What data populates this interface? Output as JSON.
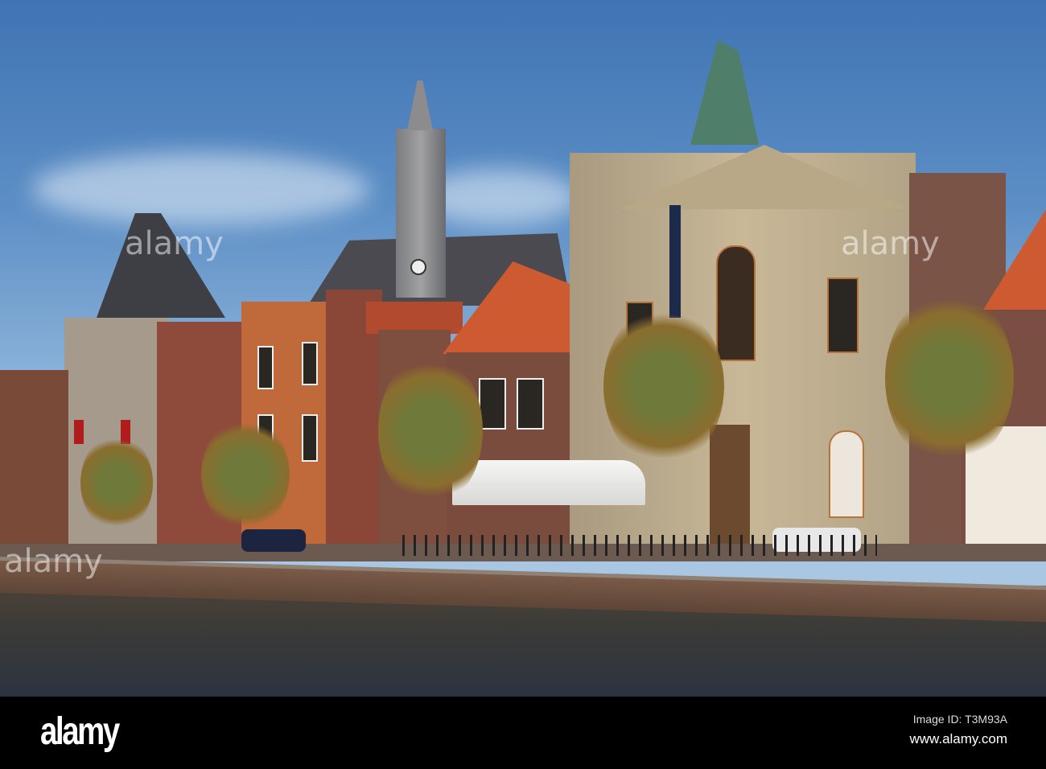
{
  "watermark": {
    "logo": "alamy",
    "image_id": "Image ID: T3M93A",
    "url": "www.alamy.com"
  },
  "colors": {
    "sky": "#4f83bf",
    "brick": "#9b4a32",
    "stone": "#b9a88c",
    "roof_orange": "#c8572e",
    "water": "#3b3a38"
  }
}
